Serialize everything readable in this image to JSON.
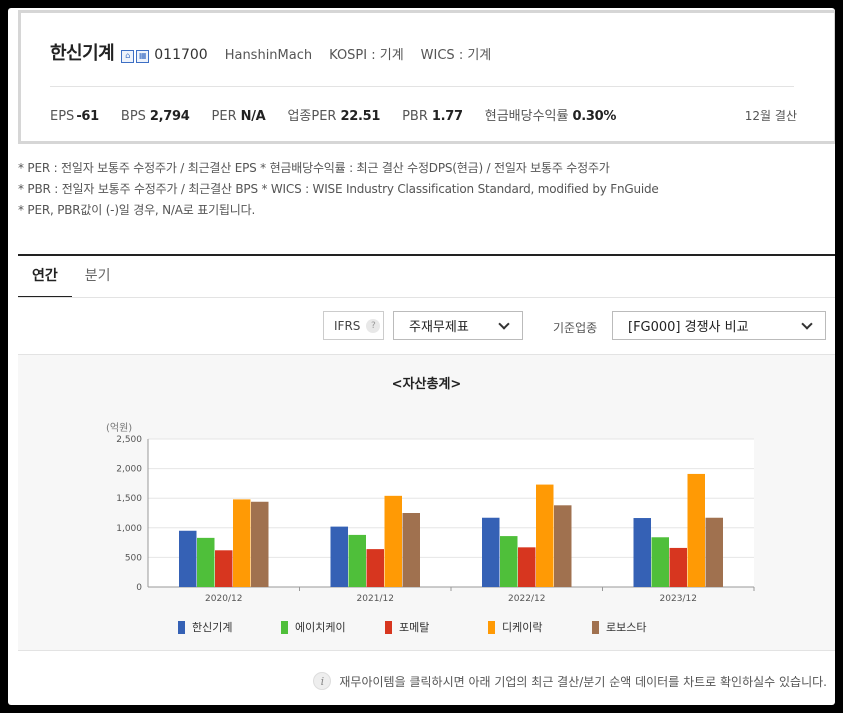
{
  "company": {
    "name": "한신기계",
    "code": "011700",
    "english_name": "HanshinMach",
    "market": "KOSPI : 기계",
    "wics": "WICS : 기계",
    "icons": [
      "home-icon",
      "building-icon"
    ]
  },
  "metrics": [
    {
      "label": "EPS",
      "value": "-61"
    },
    {
      "label": "BPS",
      "value": "2,794"
    },
    {
      "label": "PER",
      "value": "N/A"
    },
    {
      "label": "업종PER",
      "value": "22.51"
    },
    {
      "label": "PBR",
      "value": "1.77"
    },
    {
      "label": "현금배당수익률",
      "value": "0.30%"
    }
  ],
  "settlement": "12월 결산",
  "notes": [
    "* PER : 전일자 보통주 수정주가 / 최근결산 EPS * 현금배당수익률 : 최근 결산 수정DPS(현금) / 전일자 보통주 수정주가",
    "* PBR : 전일자 보통주 수정주가 / 최근결산 BPS * WICS : WISE Industry Classification Standard, modified by FnGuide",
    "* PER, PBR값이 (-)일 경우, N/A로 표기됩니다."
  ],
  "tabs": [
    {
      "label": "연간",
      "active": true
    },
    {
      "label": "분기",
      "active": false
    }
  ],
  "controls": {
    "ifrs_label": "IFRS",
    "help_glyph": "?",
    "statement_select": "주재무제표",
    "basis_label": "기준업종",
    "comparison_select": "[FG000] 경쟁사 비교"
  },
  "chart_data": {
    "type": "bar",
    "title": "<자산총계>",
    "unit_label": "(억원)",
    "categories": [
      "2020/12",
      "2021/12",
      "2022/12",
      "2023/12"
    ],
    "ylim": [
      0,
      2500
    ],
    "yticks": [
      "0",
      "500",
      "1,000",
      "1,500",
      "2,000",
      "2,500"
    ],
    "ytick_values": [
      0,
      500,
      1000,
      1500,
      2000,
      2500
    ],
    "grid": true,
    "legend_position": "bottom",
    "series": [
      {
        "name": "한신기계",
        "color": "#3561b5",
        "values": [
          950,
          1020,
          1170,
          1165
        ]
      },
      {
        "name": "에이치케이",
        "color": "#4fbf3a",
        "values": [
          830,
          880,
          860,
          840
        ]
      },
      {
        "name": "포메탈",
        "color": "#d7361f",
        "values": [
          620,
          640,
          670,
          660
        ]
      },
      {
        "name": "디케이락",
        "color": "#ff9a05",
        "values": [
          1480,
          1540,
          1730,
          1910
        ]
      },
      {
        "name": "로보스타",
        "color": "#a0714f",
        "values": [
          1440,
          1250,
          1380,
          1170
        ]
      }
    ]
  },
  "footer": {
    "info_glyph": "i",
    "text": "재무아이템을 클릭하시면 아래 기업의 최근 결산/분기 순액 데이터를 차트로 확인하실수 있습니다."
  }
}
